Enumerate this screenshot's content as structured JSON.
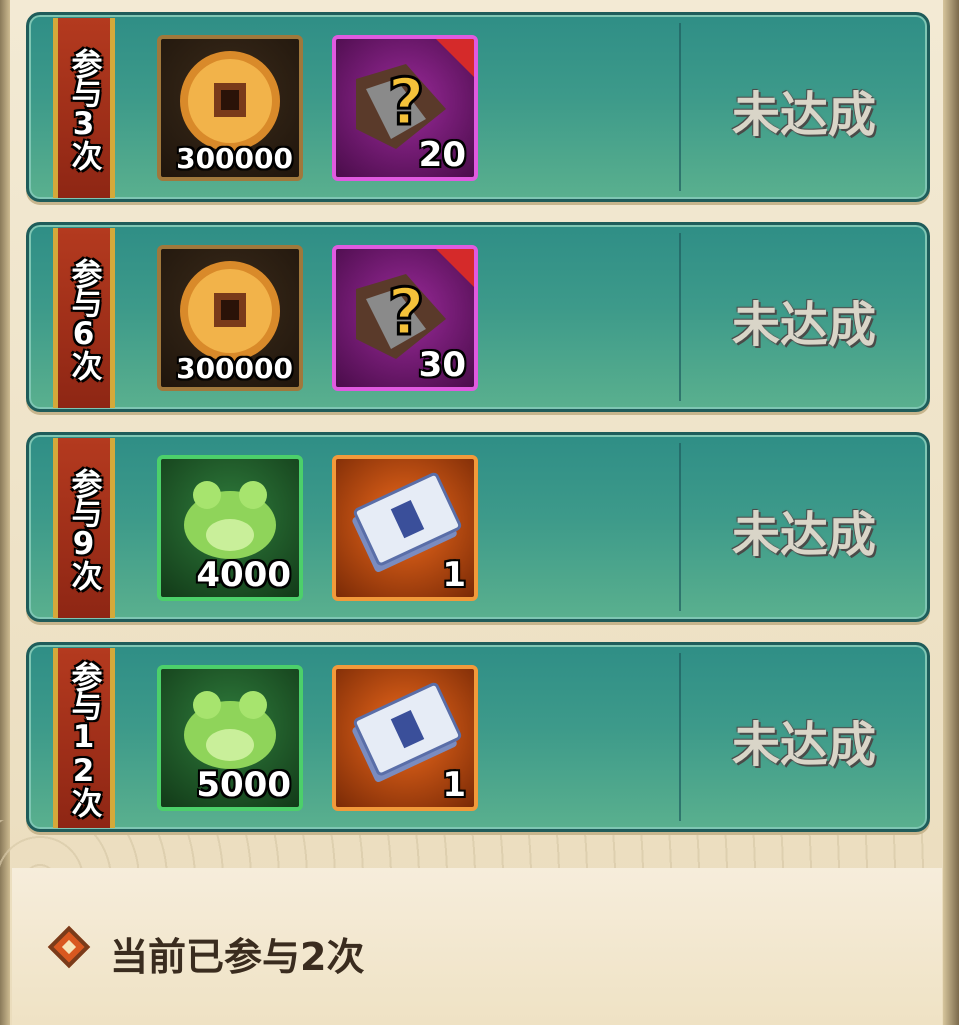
{
  "rewards": [
    {
      "banner": "参与3次",
      "items": [
        {
          "type": "copper-coin",
          "qty": "300000",
          "frame": "gold"
        },
        {
          "type": "mystery-box",
          "qty": "20",
          "frame": "purple"
        }
      ],
      "status": "未达成"
    },
    {
      "banner": "参与6次",
      "items": [
        {
          "type": "copper-coin",
          "qty": "300000",
          "frame": "gold"
        },
        {
          "type": "mystery-box",
          "qty": "30",
          "frame": "purple"
        }
      ],
      "status": "未达成"
    },
    {
      "banner": "参与9次",
      "items": [
        {
          "type": "green-frog",
          "qty": "4000",
          "frame": "green"
        },
        {
          "type": "ticket",
          "qty": "1",
          "frame": "orange"
        }
      ],
      "status": "未达成"
    },
    {
      "banner": "参与12次",
      "items": [
        {
          "type": "green-frog",
          "qty": "5000",
          "frame": "green"
        },
        {
          "type": "ticket",
          "qty": "1",
          "frame": "orange"
        }
      ],
      "status": "未达成"
    }
  ],
  "footer": {
    "text": "当前已参与2次"
  },
  "colors": {
    "row_bg": "#3d9a8a",
    "banner_red": "#b43a1f",
    "status_text": "#d9d5c8"
  }
}
